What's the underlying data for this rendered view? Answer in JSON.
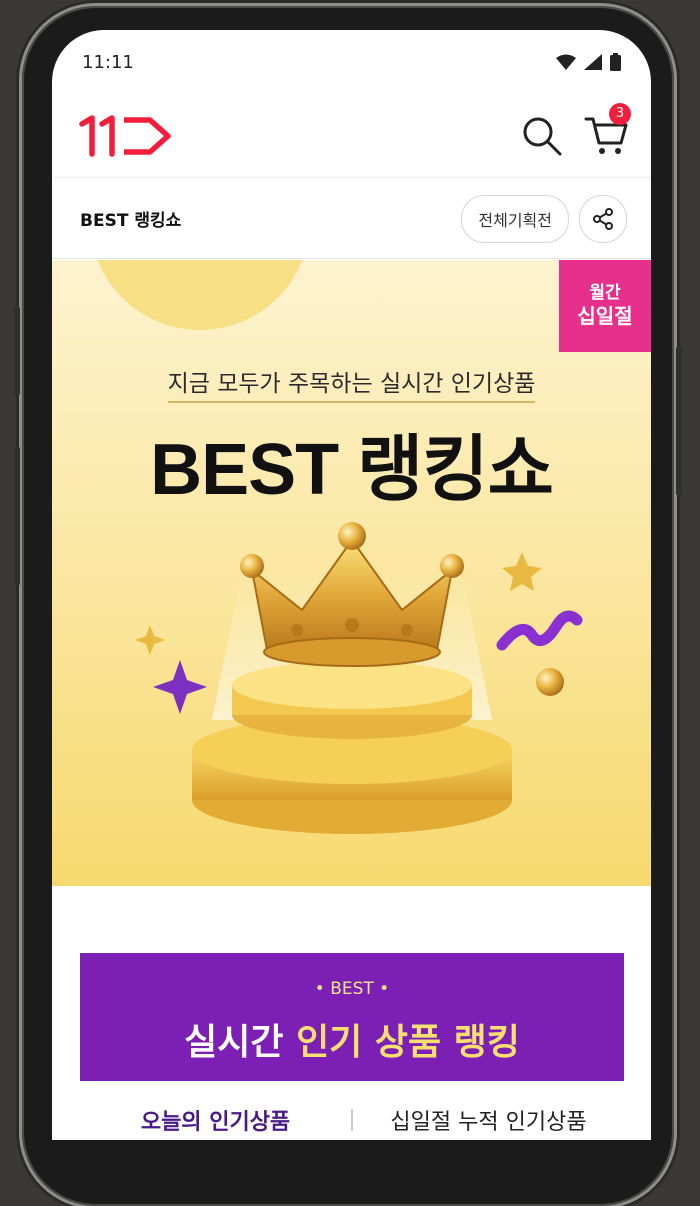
{
  "status_bar": {
    "time": "11:11",
    "icons": [
      "wifi-icon",
      "cellular-signal-icon",
      "battery-icon"
    ]
  },
  "app_bar": {
    "logo_icon": "11st-logo-icon",
    "search_icon": "search-icon",
    "cart_icon": "cart-icon",
    "cart_count": "3"
  },
  "sub_bar": {
    "title": "BEST 랭킹쇼",
    "all_events_label": "전체기획전",
    "share_icon": "share-icon"
  },
  "hero": {
    "badge_line1": "월간",
    "badge_line2": "십일절",
    "subtitle": "지금 모두가 주목하는 실시간 인기상품",
    "title": "BEST 랭킹쇼"
  },
  "ranking_banner": {
    "small_label": "• BEST •",
    "title_part1": "실시간",
    "title_part2": "인기 상품 랭킹"
  },
  "tabs": [
    {
      "label": "오늘의 인기상품",
      "active": true
    },
    {
      "label": "십일절 누적 인기상품",
      "active": false
    }
  ],
  "colors": {
    "brand_red": "#f21e3c",
    "promo_pink": "#e7308b",
    "ranking_purple": "#7c1fb5",
    "highlight_yellow": "#f7e071"
  }
}
